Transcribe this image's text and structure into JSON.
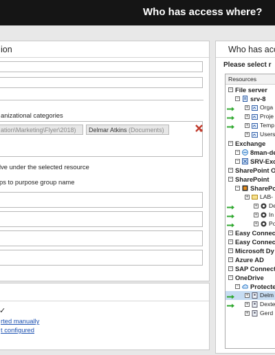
{
  "app": {
    "title": "Who has access where?"
  },
  "left_panel": {
    "title": "ion",
    "categories_label": "anizational categories",
    "chips": [
      {
        "path": "ation\\Marketing\\Flyer\\2018)",
        "name": "",
        "sub": ""
      },
      {
        "path": "",
        "name": "Delmar Atkins",
        "sub": "(Documents)"
      }
    ],
    "option1": "lve under the selected resource",
    "option2": "ps to purpose group name",
    "check_mark": "✓",
    "link1": "rted manually",
    "link2": "t configured"
  },
  "right_panel": {
    "title": "Who has acc",
    "prompt": "Please select r",
    "header": "Resources"
  },
  "tree": [
    {
      "label": "File server",
      "bold": true,
      "indent": 0,
      "icon": "none",
      "arrow": false,
      "sel": false
    },
    {
      "label": "srv-8",
      "bold": true,
      "indent": 1,
      "icon": "server-icon",
      "arrow": false,
      "sel": false
    },
    {
      "label": "Orga",
      "bold": false,
      "indent": 2,
      "icon": "share-folder-icon",
      "arrow": true,
      "sel": false
    },
    {
      "label": "Proje",
      "bold": false,
      "indent": 2,
      "icon": "share-folder-icon",
      "arrow": true,
      "sel": false
    },
    {
      "label": "Temp",
      "bold": false,
      "indent": 2,
      "icon": "share-folder-icon",
      "arrow": true,
      "sel": false
    },
    {
      "label": "Users",
      "bold": false,
      "indent": 2,
      "icon": "share-folder-icon",
      "arrow": false,
      "sel": false
    },
    {
      "label": "Exchange",
      "bold": true,
      "indent": 0,
      "icon": "none",
      "arrow": false,
      "sel": false
    },
    {
      "label": "8man-de",
      "bold": true,
      "indent": 1,
      "icon": "exchange-icon",
      "arrow": false,
      "sel": false
    },
    {
      "label": "SRV-Exc",
      "bold": true,
      "indent": 1,
      "icon": "exchange-server-icon",
      "arrow": false,
      "sel": false
    },
    {
      "label": "SharePoint O",
      "bold": true,
      "indent": 0,
      "icon": "none",
      "arrow": false,
      "sel": false
    },
    {
      "label": "SharePoint",
      "bold": true,
      "indent": 0,
      "icon": "none",
      "arrow": false,
      "sel": false
    },
    {
      "label": "SharePo",
      "bold": true,
      "indent": 1,
      "icon": "sharepoint-icon",
      "arrow": false,
      "sel": false
    },
    {
      "label": "LAB-",
      "bold": false,
      "indent": 2,
      "icon": "site-icon",
      "arrow": false,
      "sel": false
    },
    {
      "label": "De",
      "bold": false,
      "indent": 3,
      "icon": "sharepoint-site-icon",
      "arrow": true,
      "sel": false
    },
    {
      "label": "In",
      "bold": false,
      "indent": 3,
      "icon": "sharepoint-site-icon",
      "arrow": true,
      "sel": false
    },
    {
      "label": "Po",
      "bold": false,
      "indent": 3,
      "icon": "sharepoint-site-icon",
      "arrow": true,
      "sel": false
    },
    {
      "label": "Easy Connect",
      "bold": true,
      "indent": 0,
      "icon": "none",
      "arrow": false,
      "sel": false
    },
    {
      "label": "Easy Connect",
      "bold": true,
      "indent": 0,
      "icon": "none",
      "arrow": false,
      "sel": false
    },
    {
      "label": "Microsoft Dy",
      "bold": true,
      "indent": 0,
      "icon": "none",
      "arrow": false,
      "sel": false
    },
    {
      "label": "Azure AD",
      "bold": true,
      "indent": 0,
      "icon": "none",
      "arrow": false,
      "sel": false
    },
    {
      "label": "SAP Connect",
      "bold": true,
      "indent": 0,
      "icon": "none",
      "arrow": false,
      "sel": false
    },
    {
      "label": "OneDrive",
      "bold": true,
      "indent": 0,
      "icon": "none",
      "arrow": false,
      "sel": false
    },
    {
      "label": "Protecte",
      "bold": true,
      "indent": 1,
      "icon": "cloud-icon",
      "arrow": false,
      "sel": false
    },
    {
      "label": "Delm",
      "bold": false,
      "indent": 2,
      "icon": "user-drive-icon",
      "arrow": true,
      "sel": true
    },
    {
      "label": "Dexte",
      "bold": false,
      "indent": 2,
      "icon": "user-drive-icon",
      "arrow": true,
      "sel": false
    },
    {
      "label": "Gerd",
      "bold": false,
      "indent": 2,
      "icon": "user-drive-icon",
      "arrow": false,
      "sel": false
    }
  ],
  "colors": {
    "topbar": "#151515",
    "arrow": "#2fa82f",
    "link": "#1a4fb0",
    "selected": "#c6dcf2",
    "remove_icon": "#c0392b"
  }
}
